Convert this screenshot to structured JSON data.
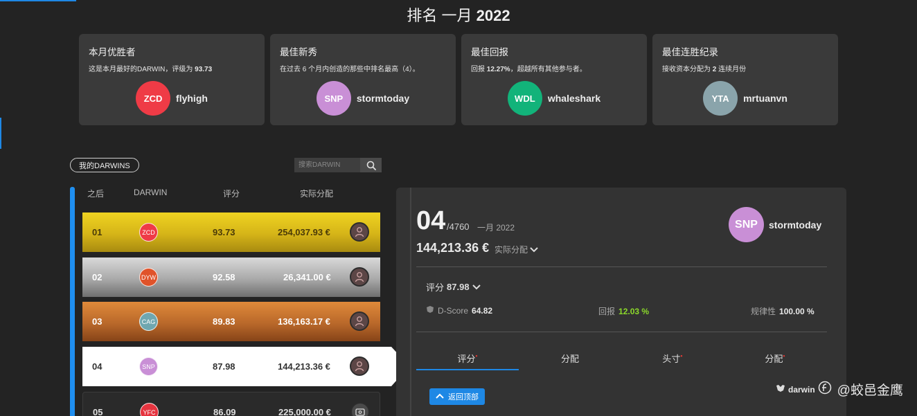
{
  "page": {
    "title_prefix": "排名 一月",
    "title_year": "2022"
  },
  "awards": [
    {
      "title": "本月优胜者",
      "desc_before": "这是本月最好的DARWIN，评级为 ",
      "desc_bold": "93.73",
      "desc_after": "",
      "avatar": "ZCD",
      "avatar_color": "#ef3b46",
      "user": "flyhigh"
    },
    {
      "title": "最佳新秀",
      "desc_before": "在过去 6 个月内创造的那些中排名最高（4）。",
      "desc_bold": "",
      "desc_after": "",
      "avatar": "SNP",
      "avatar_color": "#c98fd6",
      "user": "stormtoday"
    },
    {
      "title": "最佳回报",
      "desc_before": "回报 ",
      "desc_bold": "12.27%",
      "desc_after": "，超越所有其他参与者。",
      "avatar": "WDL",
      "avatar_color": "#12b37a",
      "user": "whaleshark"
    },
    {
      "title": "最佳连胜纪录",
      "desc_before": "接收资本分配为 ",
      "desc_bold": "2",
      "desc_after": " 连续月份",
      "avatar": "YTA",
      "avatar_color": "#8aa4ab",
      "user": "mrtuanvn"
    }
  ],
  "controls": {
    "my_darwins": "我的DARWINS",
    "search_placeholder": "搜索DARWIN"
  },
  "table": {
    "headers": {
      "after": "之后",
      "darwin": "DARWIN",
      "score": "评分",
      "allocation": "实际分配"
    },
    "rows": [
      {
        "rank": "01",
        "avatar": "ZCD",
        "avatar_color": "#ef3b46",
        "score": "93.73",
        "amount": "254,037.93 €"
      },
      {
        "rank": "02",
        "avatar": "DYW",
        "avatar_color": "#e0532a",
        "score": "92.58",
        "amount": "26,341.00 €"
      },
      {
        "rank": "03",
        "avatar": "CAG",
        "avatar_color": "#6fa7b0",
        "score": "89.83",
        "amount": "136,163.17 €"
      },
      {
        "rank": "04",
        "avatar": "SNP",
        "avatar_color": "#c98fd6",
        "score": "87.98",
        "amount": "144,213.36 €"
      },
      {
        "rank": "05",
        "avatar": "YFC",
        "avatar_color": "#e5343f",
        "score": "86.09",
        "amount": "225,000.00 €"
      }
    ]
  },
  "detail": {
    "rank": "04",
    "total": "/4760",
    "month": "一月 2022",
    "amount": "144,213.36 €",
    "alloc_label": "实际分配",
    "avatar": "SNP",
    "avatar_color": "#c98fd6",
    "user": "stormtoday",
    "score_label": "评分",
    "score_value": "87.98",
    "dscore_label": "D-Score",
    "dscore_value": "64.82",
    "return_label": "回报",
    "return_value": "12.03 %",
    "regularity_label": "规律性",
    "regularity_value": "100.00 %",
    "return_color": "#8cd92b",
    "tabs": [
      "评分",
      "分配",
      "头寸",
      "分配"
    ],
    "back_to_top": "返回顶部"
  },
  "watermark": {
    "brand": "darwin",
    "handle": "@蛟邑金鹰"
  },
  "colors": {
    "accent": "#1e88e5",
    "gold": "#e2c21c",
    "silver": "#b3b3b3",
    "bronze": "#c06d2c"
  }
}
